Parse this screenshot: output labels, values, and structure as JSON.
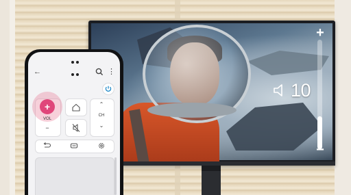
{
  "tv": {
    "volume_value": "10",
    "volume_level_fraction": 0.3,
    "volume_plus_symbol": "+",
    "volume_minus_symbol": "−"
  },
  "remote_app": {
    "volume_button_symbol": "+",
    "volume_label": "VOL",
    "volume_minus_symbol": "−",
    "channel_label": "CH",
    "channel_up_symbol": "⌃",
    "channel_down_symbol": "⌄",
    "icons": {
      "back": "back-arrow-icon",
      "search": "search-icon",
      "more": "more-vert-icon",
      "power": "power-icon",
      "home": "home-icon",
      "mute": "mute-icon",
      "return": "return-icon",
      "input": "input-icon",
      "settings": "settings-gear-icon"
    }
  },
  "colors": {
    "accent": "#e0467a",
    "wall": "#ece6dc",
    "monitor_bezel": "#1b1d22"
  }
}
